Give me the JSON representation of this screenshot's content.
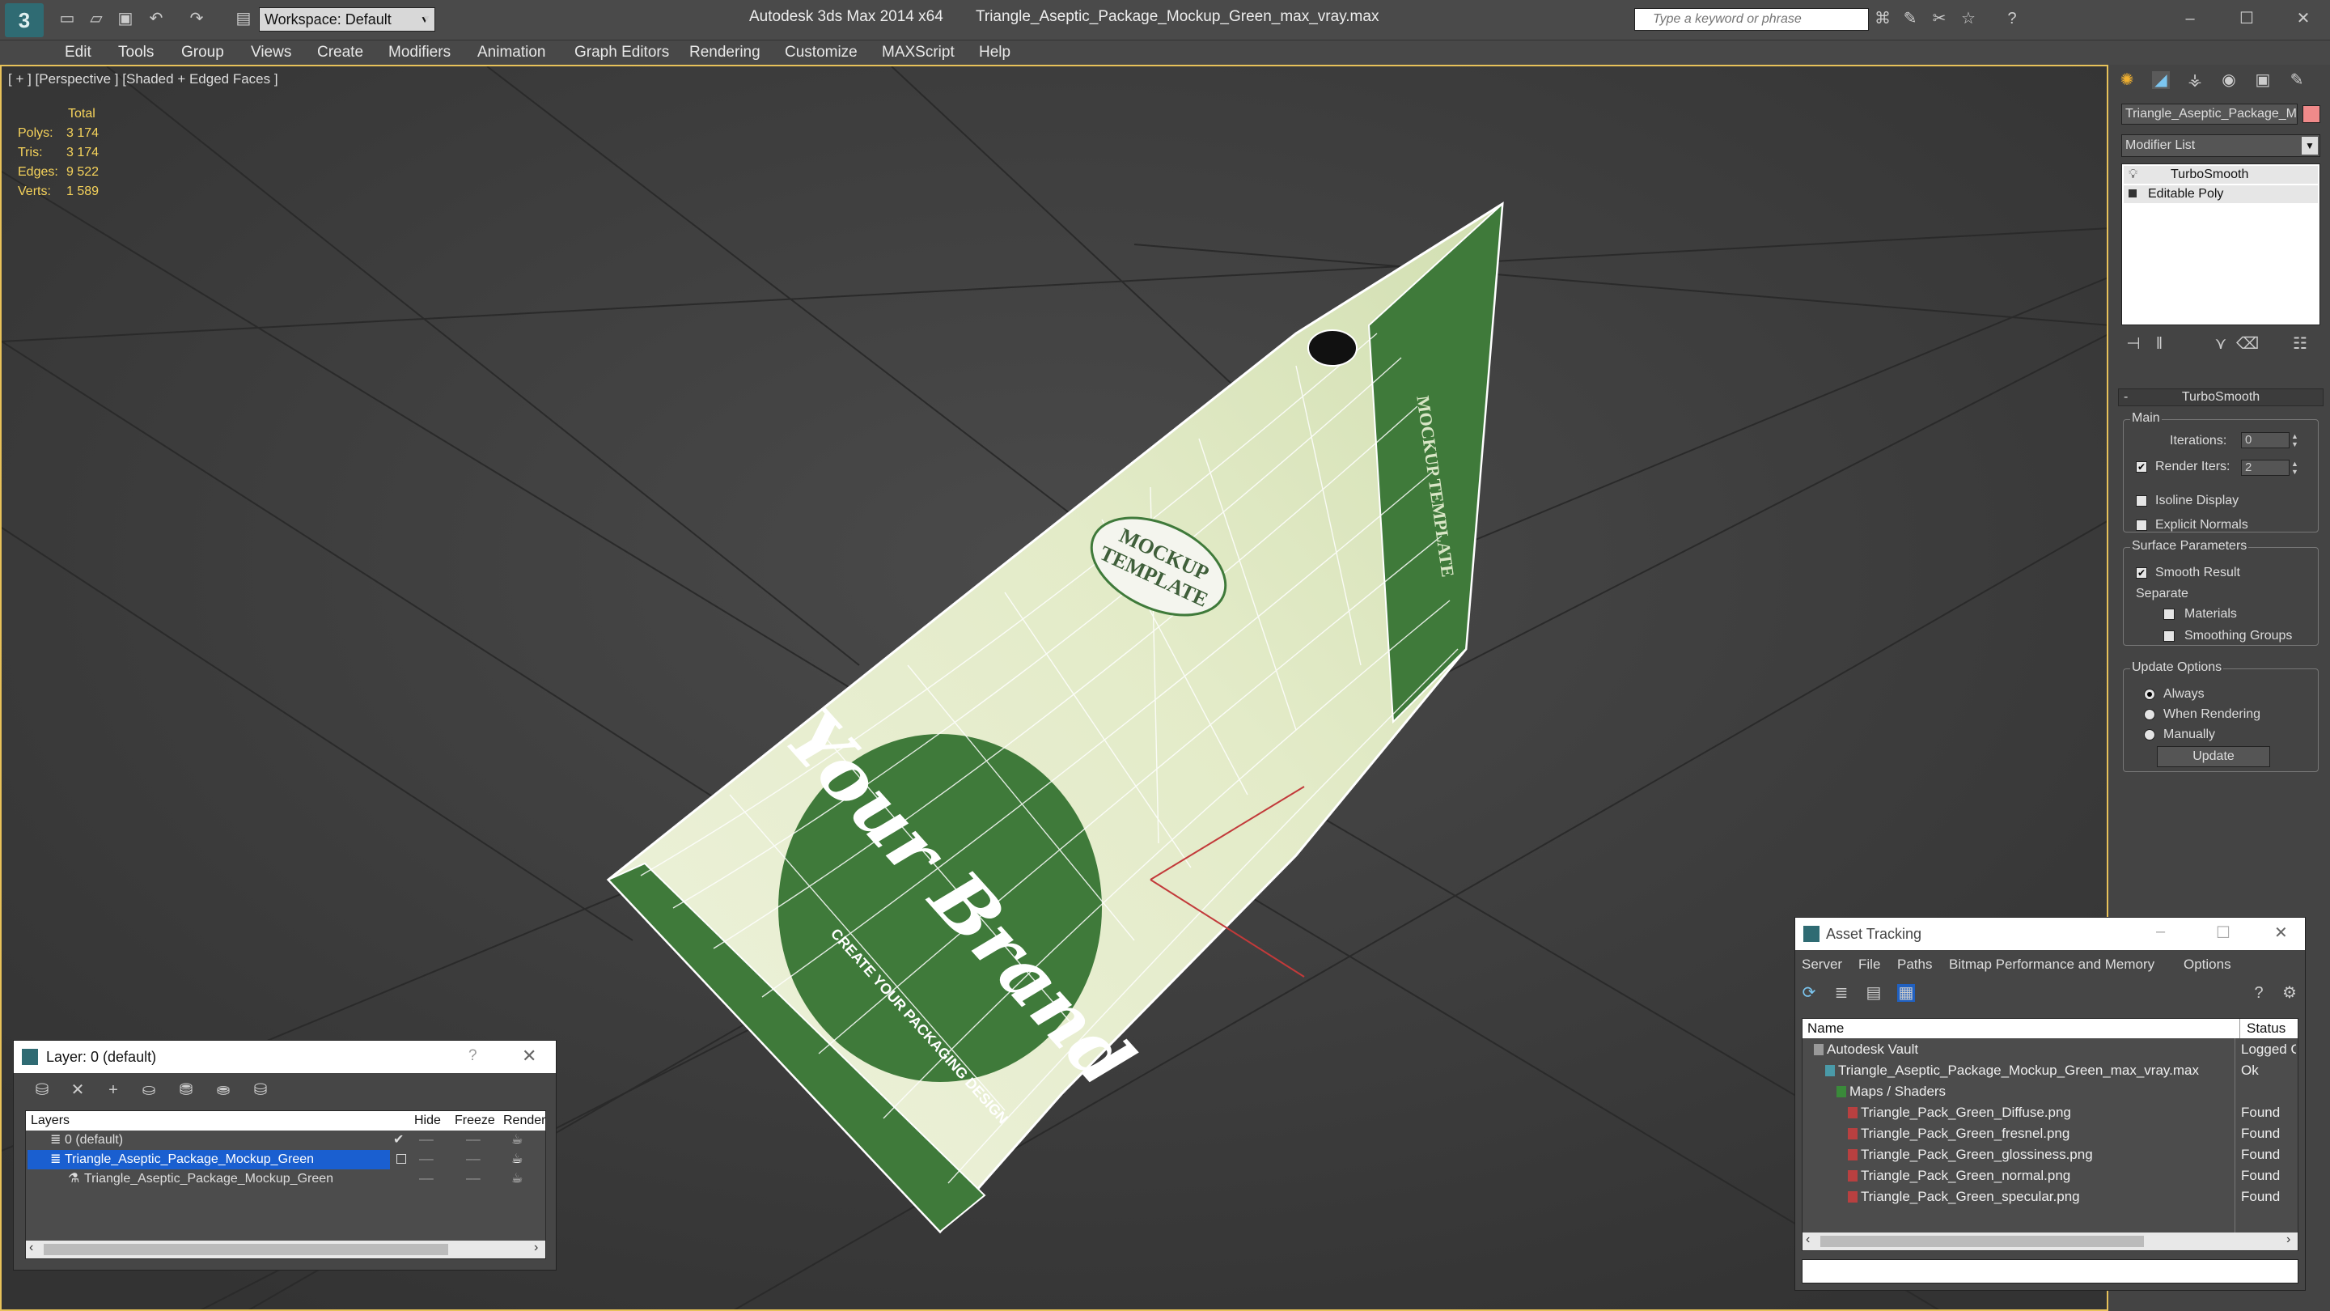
{
  "app": {
    "title": "Autodesk 3ds Max 2014 x64",
    "file": "Triangle_Aseptic_Package_Mockup_Green_max_vray.max",
    "workspace": "Workspace: Default",
    "search_placeholder": "Type a keyword or phrase"
  },
  "menu": [
    "Edit",
    "Tools",
    "Group",
    "Views",
    "Create",
    "Modifiers",
    "Animation",
    "Graph Editors",
    "Rendering",
    "Customize",
    "MAXScript",
    "Help"
  ],
  "viewport": {
    "label": "[ + ] [Perspective ] [Shaded + Edged Faces ]",
    "stats": {
      "header": "Total",
      "rows": [
        {
          "label": "Polys:",
          "value": "3 174"
        },
        {
          "label": "Tris:",
          "value": "3 174"
        },
        {
          "label": "Edges:",
          "value": "9 522"
        },
        {
          "label": "Verts:",
          "value": "1 589"
        }
      ]
    }
  },
  "command_panel": {
    "object_name": "Triangle_Aseptic_Package_M",
    "object_color": "#f08a8a",
    "modifier_list": "Modifier List",
    "stack": [
      "TurboSmooth",
      "Editable Poly"
    ],
    "rollout": "TurboSmooth",
    "main_group": "Main",
    "iterations_label": "Iterations:",
    "iterations_value": "0",
    "render_iters_label": "Render Iters:",
    "render_iters_value": "2",
    "render_iters_checked": true,
    "isoline": "Isoline Display",
    "explicit_normals": "Explicit Normals",
    "surface_params": "Surface Parameters",
    "smooth_result": "Smooth Result",
    "separate": "Separate",
    "materials": "Materials",
    "smoothing_groups": "Smoothing Groups",
    "update_options": "Update Options",
    "always": "Always",
    "when_rendering": "When Rendering",
    "manually": "Manually",
    "update_button": "Update"
  },
  "layer_window": {
    "title": "Layer: 0 (default)",
    "help": "?",
    "columns": [
      "Layers",
      "Hide",
      "Freeze",
      "Render"
    ],
    "rows": [
      {
        "name": "0 (default)",
        "level": 1,
        "selected": false
      },
      {
        "name": "Triangle_Aseptic_Package_Mockup_Green",
        "level": 1,
        "selected": true
      },
      {
        "name": "Triangle_Aseptic_Package_Mockup_Green",
        "level": 2,
        "selected": false
      }
    ]
  },
  "asset_window": {
    "title": "Asset Tracking",
    "menu": [
      "Server",
      "File",
      "Paths",
      "Bitmap Performance and Memory",
      "Options"
    ],
    "columns": [
      "Name",
      "Status"
    ],
    "rows": [
      {
        "name": "Autodesk Vault",
        "status": "Logged O",
        "level": 1
      },
      {
        "name": "Triangle_Aseptic_Package_Mockup_Green_max_vray.max",
        "status": "Ok",
        "level": 2
      },
      {
        "name": "Maps / Shaders",
        "status": "",
        "level": 3
      },
      {
        "name": "Triangle_Pack_Green_Diffuse.png",
        "status": "Found",
        "level": 4
      },
      {
        "name": "Triangle_Pack_Green_fresnel.png",
        "status": "Found",
        "level": 4
      },
      {
        "name": "Triangle_Pack_Green_glossiness.png",
        "status": "Found",
        "level": 4
      },
      {
        "name": "Triangle_Pack_Green_normal.png",
        "status": "Found",
        "level": 4
      },
      {
        "name": "Triangle_Pack_Green_specular.png",
        "status": "Found",
        "level": 4
      }
    ]
  },
  "package": {
    "brand_text": "Your Brand",
    "badge_line1": "MOCKUP",
    "badge_line2": "TEMPLATE",
    "side_text": "MOCKUP TEMPLATE",
    "tagline": "CREATE YOUR PACKAGING DESIGN"
  }
}
